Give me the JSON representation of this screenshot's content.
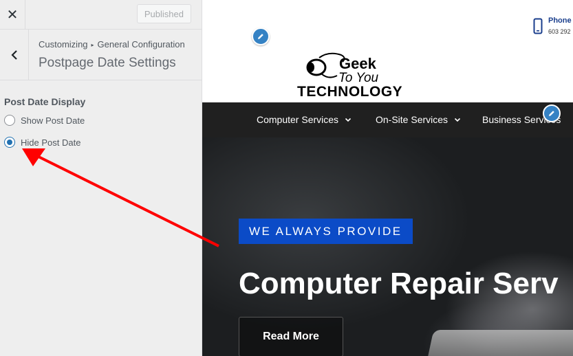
{
  "customizer": {
    "published_label": "Published",
    "breadcrumb": {
      "root": "Customizing",
      "parent": "General Configuration"
    },
    "section_title": "Postpage Date Settings",
    "control": {
      "title": "Post Date Display",
      "options": [
        {
          "label": "Show Post Date",
          "checked": false
        },
        {
          "label": "Hide Post Date",
          "checked": true
        }
      ]
    }
  },
  "site": {
    "logo": {
      "line1": "Geek",
      "line2": "To You",
      "line3": "TECHNOLOGY"
    },
    "phone": {
      "label": "Phone",
      "number": "603 292"
    },
    "nav": [
      "Computer Services",
      "On-Site Services",
      "Business Services"
    ],
    "hero": {
      "badge": "WE ALWAYS PROVIDE",
      "title": "Computer Repair Serv",
      "button": "Read More"
    }
  },
  "colors": {
    "accent": "#2271b1",
    "badge": "#0b4bc7",
    "annotation_arrow": "#ff0000",
    "nav_bg": "#202020"
  }
}
